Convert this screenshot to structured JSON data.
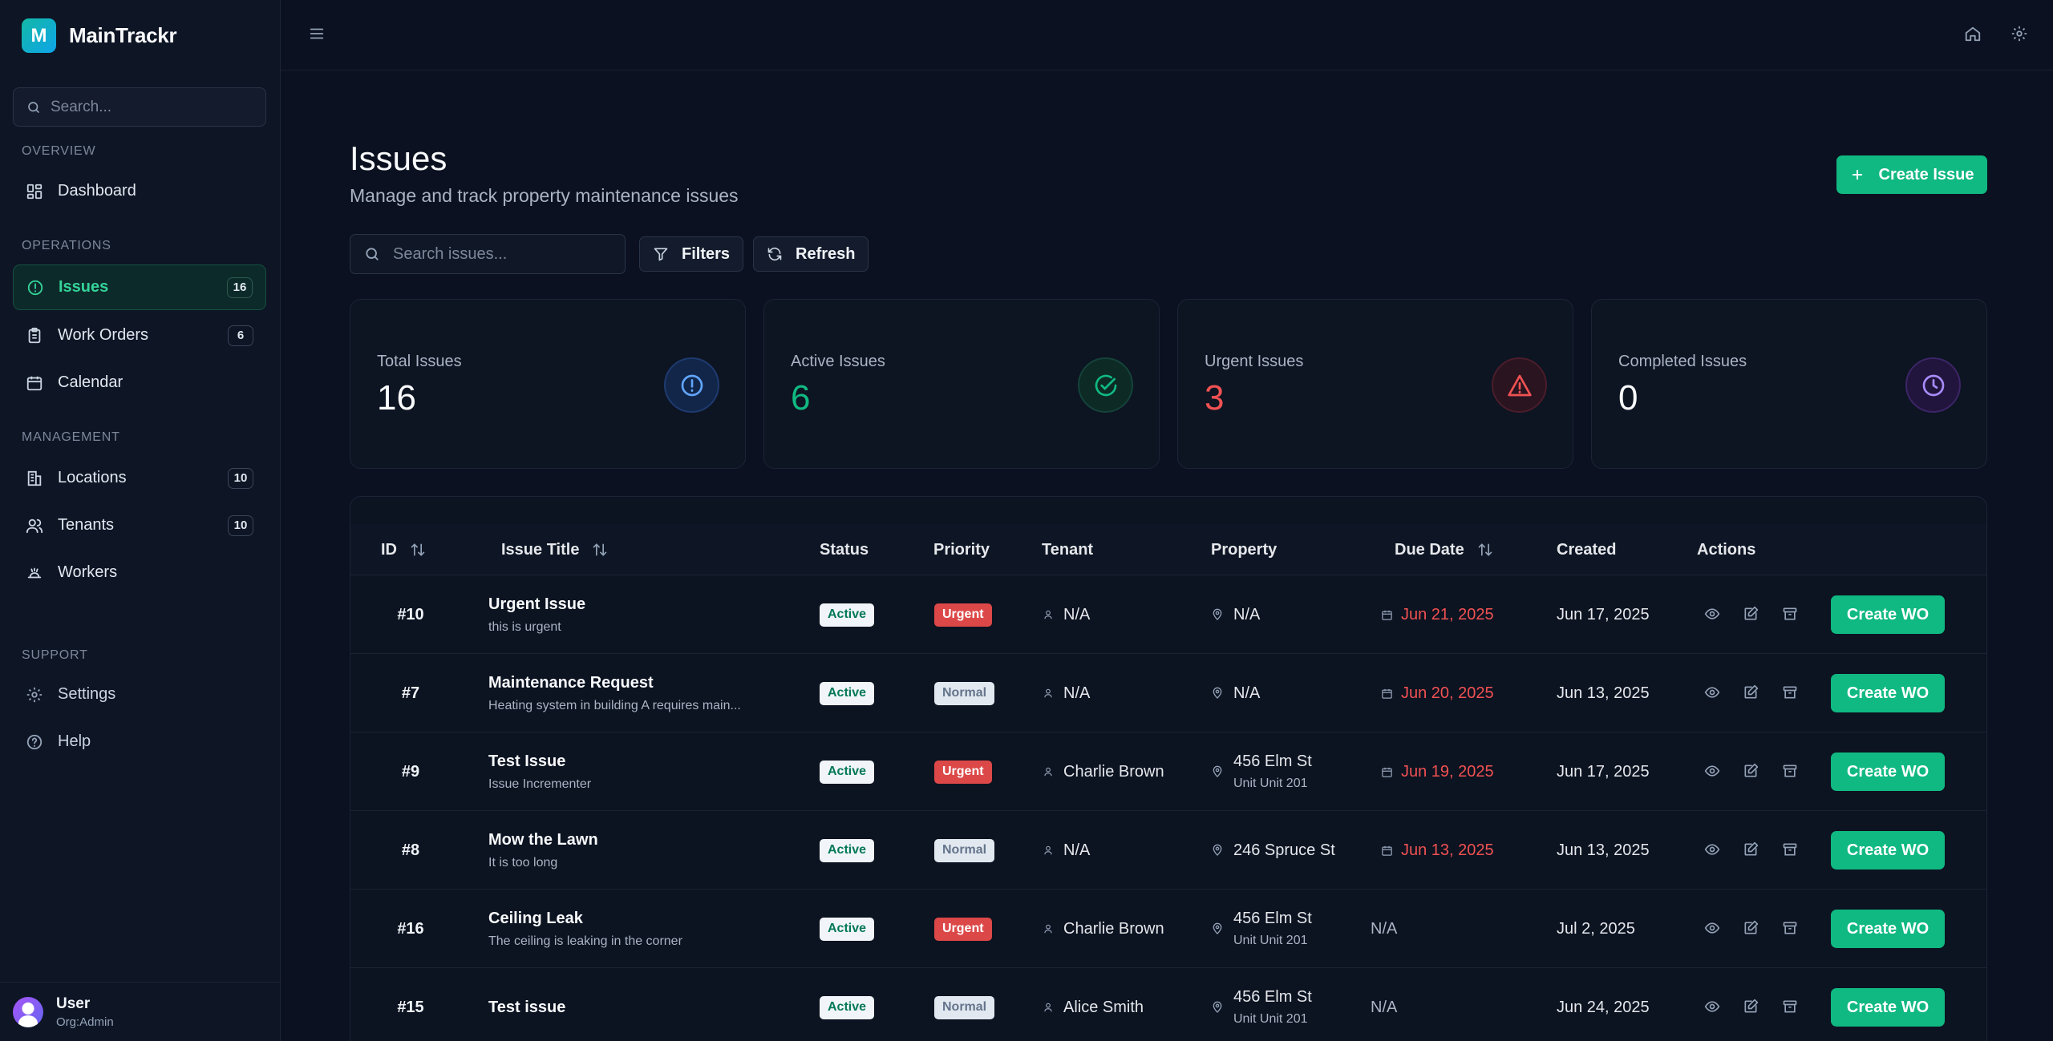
{
  "brand": {
    "logo_letter": "M",
    "name": "MainTrackr"
  },
  "sidebar": {
    "search_placeholder": "Search...",
    "sections": {
      "overview": "OVERVIEW",
      "operations": "OPERATIONS",
      "management": "MANAGEMENT",
      "support": "SUPPORT"
    },
    "items": {
      "dashboard": {
        "label": "Dashboard"
      },
      "issues": {
        "label": "Issues",
        "count": "16"
      },
      "work_orders": {
        "label": "Work Orders",
        "count": "6"
      },
      "calendar": {
        "label": "Calendar"
      },
      "locations": {
        "label": "Locations",
        "count": "10"
      },
      "tenants": {
        "label": "Tenants",
        "count": "10"
      },
      "workers": {
        "label": "Workers"
      },
      "settings": {
        "label": "Settings"
      },
      "help": {
        "label": "Help"
      }
    },
    "user": {
      "name": "User",
      "org": "Org:Admin"
    }
  },
  "page": {
    "title": "Issues",
    "subtitle": "Manage and track property maintenance issues",
    "create_button": "Create Issue",
    "search_placeholder": "Search issues...",
    "filters_label": "Filters",
    "refresh_label": "Refresh"
  },
  "stats": {
    "total": {
      "label": "Total Issues",
      "value": "16",
      "color": "#f8fafc"
    },
    "active": {
      "label": "Active Issues",
      "value": "6",
      "color": "#10b981"
    },
    "urgent": {
      "label": "Urgent Issues",
      "value": "3",
      "color": "#f05252"
    },
    "completed": {
      "label": "Completed Issues",
      "value": "0",
      "color": "#f8fafc"
    }
  },
  "table": {
    "headers": {
      "id": "ID",
      "title": "Issue Title",
      "status": "Status",
      "priority": "Priority",
      "tenant": "Tenant",
      "property": "Property",
      "due": "Due Date",
      "created": "Created",
      "actions": "Actions"
    },
    "action_button": "Create WO",
    "rows": [
      {
        "id": "#10",
        "title": "Urgent Issue",
        "desc": "this is urgent",
        "status": "Active",
        "priority": "Urgent",
        "tenant": "N/A",
        "property": "N/A",
        "unit": "",
        "due": "Jun 21, 2025",
        "created": "Jun 17, 2025"
      },
      {
        "id": "#7",
        "title": "Maintenance Request",
        "desc": "Heating system in building A requires main...",
        "status": "Active",
        "priority": "Normal",
        "tenant": "N/A",
        "property": "N/A",
        "unit": "",
        "due": "Jun 20, 2025",
        "created": "Jun 13, 2025"
      },
      {
        "id": "#9",
        "title": "Test Issue",
        "desc": "Issue Incrementer",
        "status": "Active",
        "priority": "Urgent",
        "tenant": "Charlie Brown",
        "property": "456 Elm St",
        "unit": "Unit Unit 201",
        "due": "Jun 19, 2025",
        "created": "Jun 17, 2025"
      },
      {
        "id": "#8",
        "title": "Mow the Lawn",
        "desc": "It is too long",
        "status": "Active",
        "priority": "Normal",
        "tenant": "N/A",
        "property": "246 Spruce St",
        "unit": "",
        "due": "Jun 13, 2025",
        "created": "Jun 13, 2025"
      },
      {
        "id": "#16",
        "title": "Ceiling Leak",
        "desc": "The ceiling is leaking in the corner",
        "status": "Active",
        "priority": "Urgent",
        "tenant": "Charlie Brown",
        "property": "456 Elm St",
        "unit": "Unit Unit 201",
        "due": "N/A",
        "created": "Jul 2, 2025"
      },
      {
        "id": "#15",
        "title": "Test issue",
        "desc": "",
        "status": "Active",
        "priority": "Normal",
        "tenant": "Alice Smith",
        "property": "456 Elm St",
        "unit": "Unit Unit 201",
        "due": "N/A",
        "created": "Jun 24, 2025"
      }
    ]
  },
  "icons": [
    "search-icon",
    "dashboard-icon",
    "alert-circle-icon",
    "clipboard-icon",
    "calendar-icon",
    "building-icon",
    "users-icon",
    "worker-icon",
    "gear-icon",
    "help-icon",
    "menu-icon",
    "home-icon",
    "plus-icon",
    "filter-icon",
    "refresh-icon",
    "check-circle-icon",
    "warning-triangle-icon",
    "clock-icon",
    "sort-icon",
    "user-icon",
    "map-pin-icon",
    "eye-icon",
    "edit-icon",
    "archive-icon"
  ]
}
